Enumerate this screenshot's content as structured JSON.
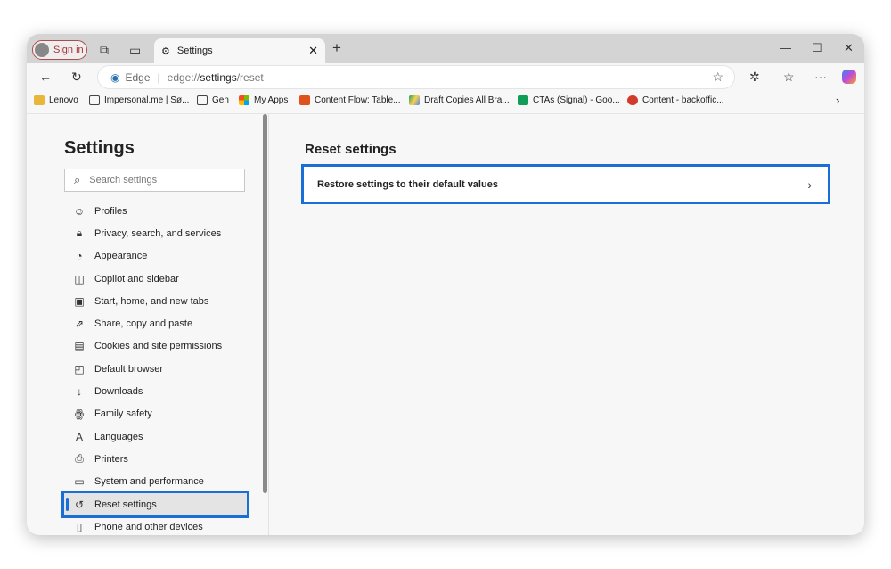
{
  "browser": {
    "sign_in": "Sign in",
    "tab_title": "Settings",
    "address_brand": "Edge",
    "address_prefix": "edge://",
    "address_bold": "settings",
    "address_suffix": "/reset"
  },
  "bookmarks": [
    {
      "label": "Lenovo",
      "color": "#e8b73a"
    },
    {
      "label": "Impersonal.me | Sø...",
      "color": "#ffffff"
    },
    {
      "label": "Gen",
      "color": "#ffffff"
    },
    {
      "label": "My Apps",
      "color": "#f25022"
    },
    {
      "label": "Content Flow: Table...",
      "color": "#e0521b"
    },
    {
      "label": "Draft Copies All Bra...",
      "color": "#1fa463"
    },
    {
      "label": "CTAs (Signal) - Goo...",
      "color": "#0f9d58"
    },
    {
      "label": "Content - backoffic...",
      "color": "#d23b2a"
    }
  ],
  "sidebar": {
    "title": "Settings",
    "search_placeholder": "Search settings",
    "items": [
      {
        "label": "Profiles",
        "icon": "profile-icon"
      },
      {
        "label": "Privacy, search, and services",
        "icon": "lock-icon"
      },
      {
        "label": "Appearance",
        "icon": "palette-icon"
      },
      {
        "label": "Copilot and sidebar",
        "icon": "sidebar-icon"
      },
      {
        "label": "Start, home, and new tabs",
        "icon": "home-tabs-icon"
      },
      {
        "label": "Share, copy and paste",
        "icon": "share-icon"
      },
      {
        "label": "Cookies and site permissions",
        "icon": "cookies-icon"
      },
      {
        "label": "Default browser",
        "icon": "browser-icon"
      },
      {
        "label": "Downloads",
        "icon": "download-icon"
      },
      {
        "label": "Family safety",
        "icon": "family-icon"
      },
      {
        "label": "Languages",
        "icon": "languages-icon"
      },
      {
        "label": "Printers",
        "icon": "printer-icon"
      },
      {
        "label": "System and performance",
        "icon": "laptop-icon"
      },
      {
        "label": "Reset settings",
        "icon": "reset-icon",
        "active": true
      },
      {
        "label": "Phone and other devices",
        "icon": "phone-icon"
      }
    ]
  },
  "main": {
    "title": "Reset settings",
    "restore_label": "Restore settings to their default values"
  },
  "colors": {
    "accent": "#1a6fd6"
  }
}
